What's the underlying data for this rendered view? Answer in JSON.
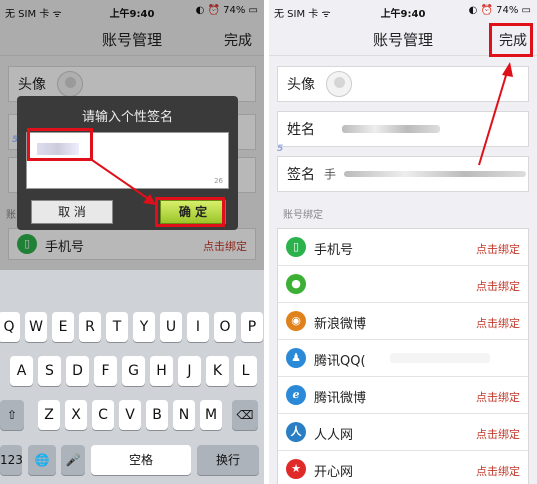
{
  "status": {
    "carrier": "无 SIM 卡 ᯤ",
    "time": "上午9:40",
    "battery": "◐ ⏰ 74% ▭"
  },
  "nav": {
    "title": "账号管理",
    "done": "完成"
  },
  "profile": {
    "avatar_label": "头像",
    "name_label": "姓名",
    "signature_label": "签名",
    "signature_value_prefix": "手"
  },
  "left_partial": {
    "name_label": "姓",
    "signature_label": "签",
    "section_label": "账",
    "phone": "手机号",
    "phone_action": "点击绑定"
  },
  "bind_section": {
    "title": "账号绑定",
    "items": [
      {
        "name": "手机号",
        "action": "点击绑定",
        "icon": "phone-icon",
        "color": "#2bb24c"
      },
      {
        "name": "",
        "action": "点击绑定",
        "icon": "wechat-icon",
        "color": "#3cb034"
      },
      {
        "name": "新浪微博",
        "action": "点击绑定",
        "icon": "weibo-icon",
        "color": "#e0821b"
      },
      {
        "name": "腾讯QQ(",
        "action": "",
        "icon": "qq-icon",
        "color": "#2a8ad8"
      },
      {
        "name": "腾讯微博",
        "action": "点击绑定",
        "icon": "tencent-weibo-icon",
        "color": "#2a8ad8"
      },
      {
        "name": "人人网",
        "action": "点击绑定",
        "icon": "renren-icon",
        "color": "#2a7fc4"
      },
      {
        "name": "开心网",
        "action": "点击绑定",
        "icon": "kaixin-icon",
        "color": "#e02a2a"
      }
    ]
  },
  "dialog": {
    "title": "请输入个性签名",
    "counter": "26",
    "cancel": "取 消",
    "ok": "确 定"
  },
  "keyboard": {
    "row1": [
      "Q",
      "W",
      "E",
      "R",
      "T",
      "Y",
      "U",
      "I",
      "O",
      "P"
    ],
    "row2": [
      "A",
      "S",
      "D",
      "F",
      "G",
      "H",
      "J",
      "K",
      "L"
    ],
    "row3": [
      "Z",
      "X",
      "C",
      "V",
      "B",
      "N",
      "M"
    ],
    "shift": "⇧",
    "delete": "⌫",
    "num": "123",
    "globe": "🌐",
    "mic": "🎤",
    "space": "空格",
    "return": "换行"
  },
  "colors": {
    "highlight": "#e0101a",
    "ok_button": "#9cc52a",
    "bind_action": "#c0392b"
  }
}
